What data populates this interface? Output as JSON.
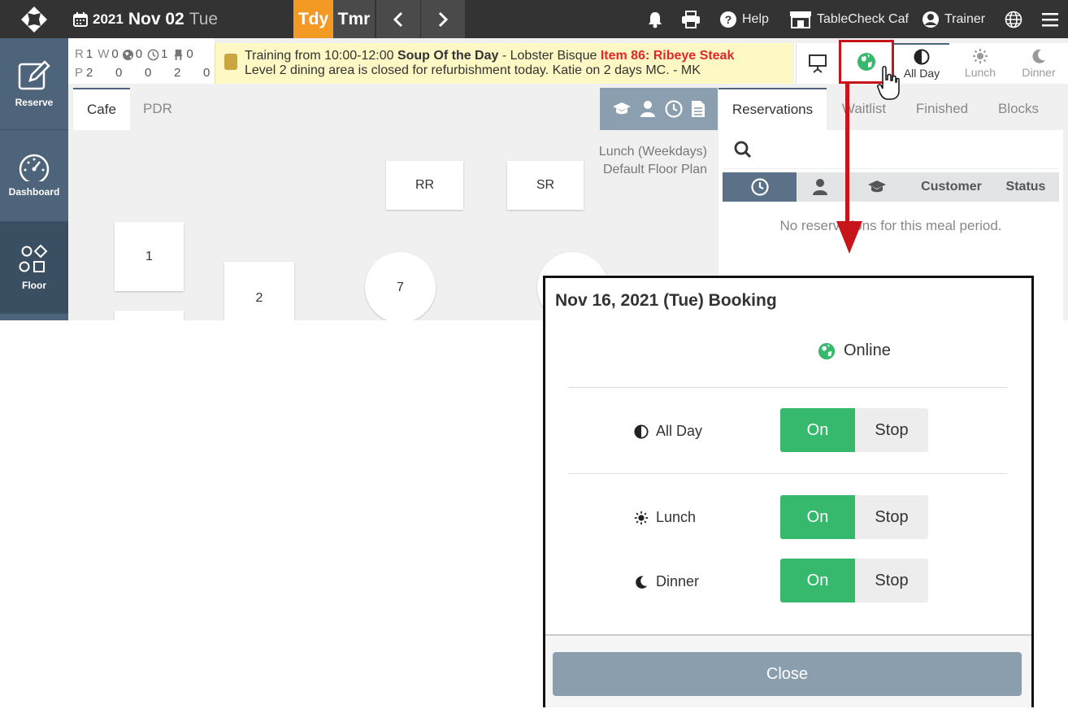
{
  "header": {
    "year": "2021",
    "month_day": "Nov 02",
    "weekday": "Tue",
    "today_label": "Tdy",
    "tomorrow_label": "Tmr",
    "help_label": "Help",
    "venue_label": "TableCheck Caf",
    "user_label": "Trainer"
  },
  "stats": {
    "r_label": "R",
    "r_value": "1",
    "w_label": "W",
    "w_value": "0",
    "online_value": "0",
    "clock_value": "1",
    "seat_value": "0",
    "p_label": "P",
    "p_values": [
      "2",
      "0",
      "0",
      "2",
      "0"
    ]
  },
  "notice": {
    "line1_prefix": "Training from 10:00-12:00 ",
    "line1_bold": "Soup Of the Day",
    "line1_mid": " - Lobster Bisque ",
    "line1_red": "Item 86: Ribeye Steak",
    "line2": "Level 2 dining area is closed for refurbishment today. Katie on 2 days MC. - MK"
  },
  "meal_tabs": [
    {
      "label": "All Day",
      "icon": "half-circle-icon"
    },
    {
      "label": "Lunch",
      "icon": "sun-icon"
    },
    {
      "label": "Dinner",
      "icon": "moon-icon"
    }
  ],
  "sidebar": {
    "items": [
      {
        "label": "Reserve",
        "icon": "edit-icon"
      },
      {
        "label": "Dashboard",
        "icon": "gauge-icon"
      },
      {
        "label": "Floor",
        "icon": "shapes-icon"
      }
    ]
  },
  "floor": {
    "tabs": [
      "Cafe",
      "PDR"
    ],
    "plan_line1": "Lunch (Weekdays)",
    "plan_line2": "Default Floor Plan",
    "tables": [
      "RR",
      "SR",
      "1",
      "2",
      "7"
    ]
  },
  "right_panel": {
    "tabs": [
      "Reservations",
      "Waitlist",
      "Finished",
      "Blocks"
    ],
    "columns": [
      "Customer",
      "Status"
    ],
    "empty_message": "No reservations for this meal period."
  },
  "modal": {
    "title": "Nov 16, 2021 (Tue) Booking",
    "online_label": "Online",
    "rows": [
      {
        "label": "All Day",
        "on": "On",
        "stop": "Stop"
      },
      {
        "label": "Lunch",
        "on": "On",
        "stop": "Stop"
      },
      {
        "label": "Dinner",
        "on": "On",
        "stop": "Stop"
      }
    ],
    "close_label": "Close"
  },
  "colors": {
    "topbar": "#333333",
    "today_accent": "#f39a25",
    "sidebar": "#4e647a",
    "on_green": "#36b86d",
    "globe_green": "#36b86d",
    "highlight_red": "#c8151c",
    "close_button": "#8a9eae"
  }
}
